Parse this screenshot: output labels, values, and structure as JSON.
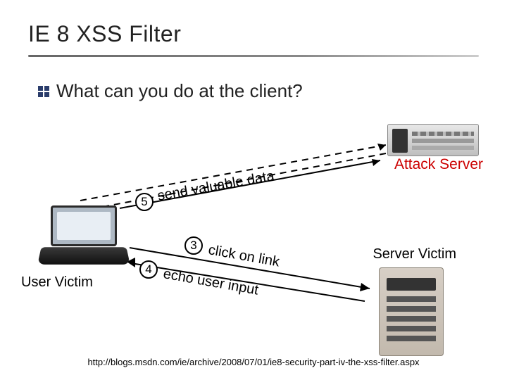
{
  "title": "IE 8 XSS Filter",
  "bullet": "What can you do at the client?",
  "labels": {
    "attack_server": "Attack Server",
    "user_victim": "User Victim",
    "server_victim": "Server Victim"
  },
  "steps": {
    "s3": {
      "num": "3",
      "text": "click on link"
    },
    "s4": {
      "num": "4",
      "text": "echo user input"
    },
    "s5": {
      "num": "5",
      "text": "send valuable data"
    }
  },
  "footer_url": "http://blogs.msdn.com/ie/archive/2008/07/01/ie8-security-part-iv-the-xss-filter.aspx"
}
